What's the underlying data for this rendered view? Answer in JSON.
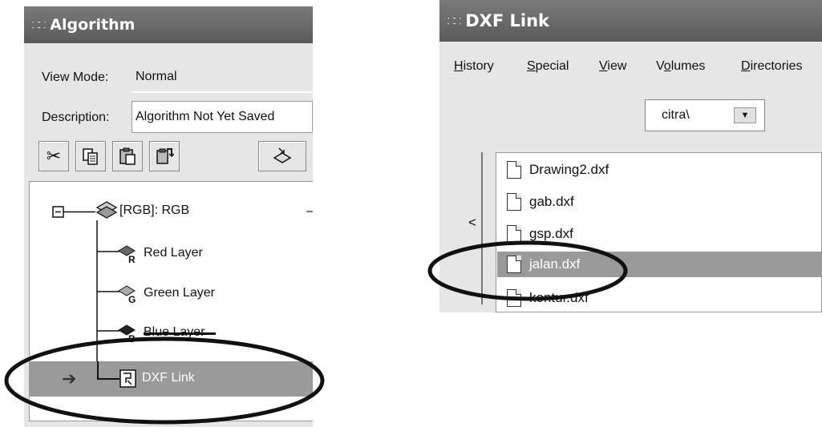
{
  "left_window": {
    "title": "Algorithm",
    "view_mode_label": "View Mode:",
    "view_mode_value": "Normal",
    "description_label": "Description:",
    "description_value": "Algorithm Not Yet Saved",
    "toolbar_icons": [
      "scissors-icon",
      "copy-icon",
      "paste-icon",
      "paste-special-icon",
      "load-icon"
    ],
    "tree": {
      "root": "[RGB]: RGB",
      "layers": [
        {
          "label": "Red Layer",
          "band": "R"
        },
        {
          "label": "Green Layer",
          "band": "G"
        },
        {
          "label": "Blue Layer",
          "band": "B"
        }
      ],
      "selected": "DXF Link"
    }
  },
  "right_window": {
    "title": "DXF Link",
    "menu": [
      "History",
      "Special",
      "View",
      "Volumes",
      "Directories"
    ],
    "menu_mnemonics": [
      "H",
      "S",
      "V",
      "o",
      "D"
    ],
    "directory_value": "citra\\",
    "scroll_arrow": "<",
    "files": [
      "Drawing2.dxf",
      "gab.dxf",
      "gsp.dxf",
      "jalan.dxf",
      "kontur.dxf"
    ],
    "selected_file": "jalan.dxf"
  },
  "colors": {
    "titlebar": "#6a6a6a",
    "window_bg": "#e6e6e6",
    "selection": "#9a9a9a",
    "highlight_ellipse": "#111111"
  }
}
